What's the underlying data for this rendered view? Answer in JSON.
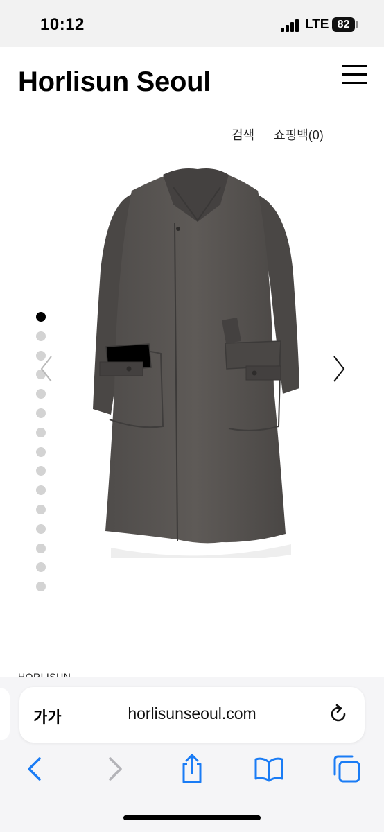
{
  "status_bar": {
    "time": "10:12",
    "network": "LTE",
    "battery": "82"
  },
  "header": {
    "logo": "Horlisun Seoul",
    "links": [
      "검색",
      "쇼핑백(0)"
    ]
  },
  "carousel": {
    "image_alt": "coat",
    "total_slides": 15,
    "active_slide": 1
  },
  "product": {
    "brand": "HORLISUN"
  },
  "browser": {
    "text_size_label": "가가",
    "url": "horlisunseoul.com",
    "accent": "#1a7cf5"
  }
}
